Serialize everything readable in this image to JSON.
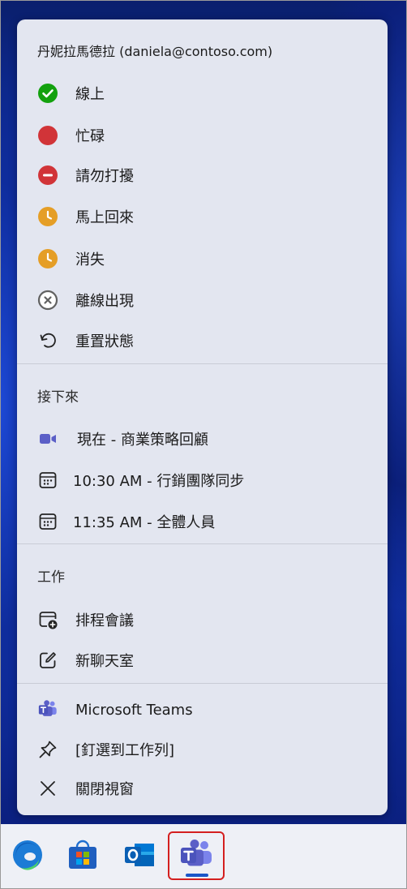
{
  "user": {
    "display": "丹妮拉馬德拉 (daniela@contoso.com)"
  },
  "status_items": [
    {
      "label": "線上",
      "icon": "available-check-icon",
      "color": "#13a10e"
    },
    {
      "label": "忙碌",
      "icon": "busy-dot-icon",
      "color": "#d13438"
    },
    {
      "label": "請勿打擾",
      "icon": "do-not-disturb-icon",
      "color": "#d13438"
    },
    {
      "label": "馬上回來",
      "icon": "be-right-back-clock-icon",
      "color": "#e59e26"
    },
    {
      "label": "消失",
      "icon": "away-clock-icon",
      "color": "#e59e26"
    },
    {
      "label": "離線出現",
      "icon": "appear-offline-x-icon",
      "color": "#616161"
    },
    {
      "label": "重置狀態",
      "icon": "reset-arrow-icon"
    }
  ],
  "upcoming": {
    "title": "接下來",
    "items": [
      {
        "label": "現在 - 商業策略回顧",
        "icon": "video-camera-icon",
        "color": "#5b5fc7"
      },
      {
        "label": "10:30 AM - 行銷團隊同步",
        "icon": "calendar-icon"
      },
      {
        "label": "11:35 AM - 全體人員",
        "icon": "calendar-icon"
      }
    ]
  },
  "work": {
    "title": "工作",
    "items": [
      {
        "label": "排程會議",
        "icon": "calendar-add-icon"
      },
      {
        "label": "新聊天室",
        "icon": "compose-icon"
      }
    ]
  },
  "app_items": [
    {
      "label": "Microsoft Teams",
      "icon": "teams-logo-icon"
    },
    {
      "label": "[釘選到工作列]",
      "icon": "pin-icon"
    },
    {
      "label": "關閉視窗",
      "icon": "close-icon"
    }
  ],
  "taskbar": [
    {
      "name": "edge-icon"
    },
    {
      "name": "store-icon"
    },
    {
      "name": "outlook-icon"
    },
    {
      "name": "teams-icon",
      "active": true
    }
  ]
}
